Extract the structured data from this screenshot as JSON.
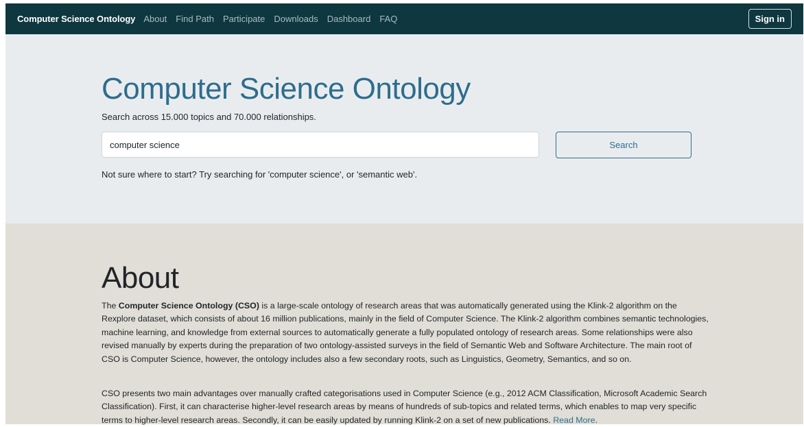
{
  "navbar": {
    "brand": "Computer Science Ontology",
    "links": [
      "About",
      "Find Path",
      "Participate",
      "Downloads",
      "Dashboard",
      "FAQ"
    ],
    "signin_label": "Sign in"
  },
  "hero": {
    "title": "Computer Science Ontology",
    "subtitle": "Search across 15.000 topics and 70.000 relationships.",
    "search_value": "computer science",
    "search_button": "Search",
    "hint": "Not sure where to start? Try searching for 'computer science', or 'semantic web'."
  },
  "about": {
    "title": "About",
    "p1_before": "The ",
    "p1_strong": "Computer Science Ontology (CSO)",
    "p1_after": " is a large-scale ontology of research areas that was automatically generated using the Klink-2 algorithm on the Rexplore dataset, which consists of about 16 million publications, mainly in the field of Computer Science. The Klink-2 algorithm combines semantic technologies, machine learning, and knowledge from external sources to automatically generate a fully populated ontology of research areas. Some relationships were also revised manually by experts during the preparation of two ontology-assisted surveys in the field of Semantic Web and Software Architecture. The main root of CSO is Computer Science, however, the ontology includes also a few secondary roots, such as Linguistics, Geometry, Semantics, and so on.",
    "p2_text": "CSO presents two main advantages over manually crafted categorisations used in Computer Science (e.g., 2012 ACM Classification, Microsoft Academic Search Classification). First, it can characterise higher-level research areas by means of hundreds of sub-topics and related terms, which enables to map very specific terms to higher-level research areas. Secondly, it can be easily updated by running Klink-2 on a set of new publications. ",
    "read_more": "Read More",
    "p2_end": "."
  },
  "colors": {
    "navbar_bg": "#0e3740",
    "accent": "#2e6d8c",
    "hero_bg": "#e9ecef",
    "about_bg": "#e0ded6"
  }
}
